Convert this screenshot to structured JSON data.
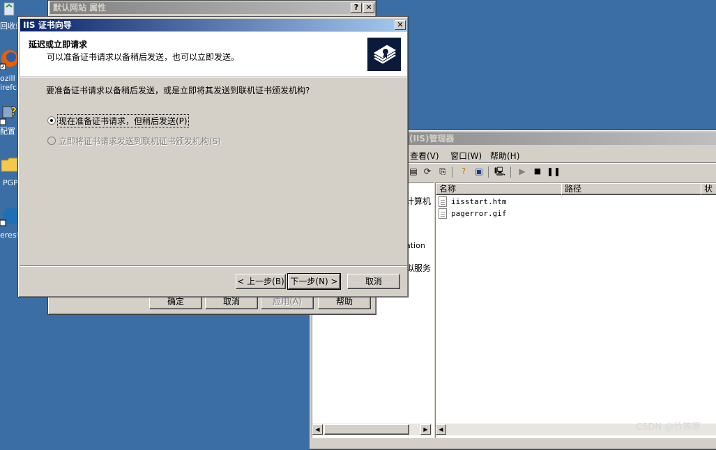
{
  "desktop": {
    "icons": [
      {
        "label": "回收站"
      },
      {
        "label": "ozill"
      },
      {
        "label": "irefc"
      },
      {
        "label": "配置"
      },
      {
        "label": "PGP"
      },
      {
        "label": "eresha"
      }
    ],
    "watermark": "CSDN @竹等寒"
  },
  "properties_dialog": {
    "title": "默认网站 属性",
    "help_btn": "?",
    "close_btn": "✕",
    "buttons": {
      "ok": "确定",
      "cancel": "取消",
      "apply": "应用(A)",
      "help": "帮助"
    }
  },
  "iis_manager": {
    "title": "(IIS)管理器",
    "menu": {
      "view": "查看(V)",
      "window": "窗口(W)",
      "help": "帮助(H)"
    },
    "tree_items": [
      "计算机",
      "ation",
      "拟服务"
    ],
    "columns": {
      "name": "名称",
      "path": "路径",
      "status": "状"
    },
    "files": [
      {
        "name": "iisstart.htm"
      },
      {
        "name": "pagerror.gif"
      }
    ]
  },
  "wizard": {
    "title": "IIS 证书向导",
    "close_btn": "✕",
    "header_title": "延迟或立即请求",
    "header_subtitle": "可以准备证书请求以备稍后发送，也可以立即发送。",
    "question": "要准备证书请求以备稍后发送，或是立即将其发送到联机证书颁发机构?",
    "options": [
      {
        "label": "现在准备证书请求，但稍后发送(P)",
        "checked": true,
        "enabled": true
      },
      {
        "label": "立即将证书请求发送到联机证书颁发机构(S)",
        "checked": false,
        "enabled": false
      }
    ],
    "buttons": {
      "back": "< 上一步(B)",
      "next": "下一步(N) >",
      "cancel": "取消"
    }
  }
}
